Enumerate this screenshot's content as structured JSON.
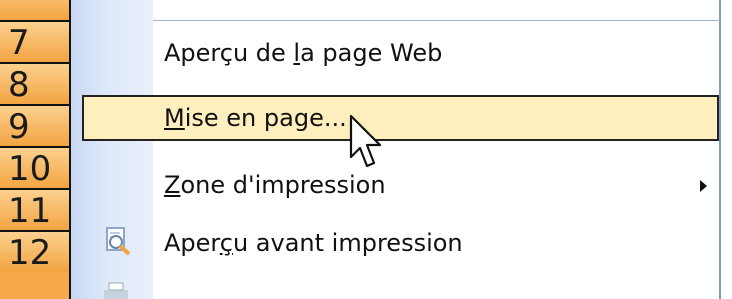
{
  "rows": [
    {
      "label": "7"
    },
    {
      "label": "8"
    },
    {
      "label": "9"
    },
    {
      "label": "10"
    },
    {
      "label": "11"
    },
    {
      "label": "12"
    }
  ],
  "menu": {
    "items": [
      {
        "label_before": "Aperçu de ",
        "mnemonic": "l",
        "label_after": "a page Web"
      },
      {
        "label_before": "",
        "mnemonic": "M",
        "label_after": "ise en page..."
      },
      {
        "label_before": "",
        "mnemonic": "Z",
        "label_after": "one d'impression"
      },
      {
        "label_before": "Aper",
        "mnemonic": "ç",
        "label_after": "u avant impression"
      }
    ]
  },
  "icons": {
    "preview": "print-preview-icon",
    "submenu": "submenu-arrow-icon",
    "cursor": "mouse-pointer-icon"
  },
  "colors": {
    "highlight": "#ffefbe",
    "row_header": "#f7a84a",
    "menu_gutter": "#dfe9fa"
  }
}
